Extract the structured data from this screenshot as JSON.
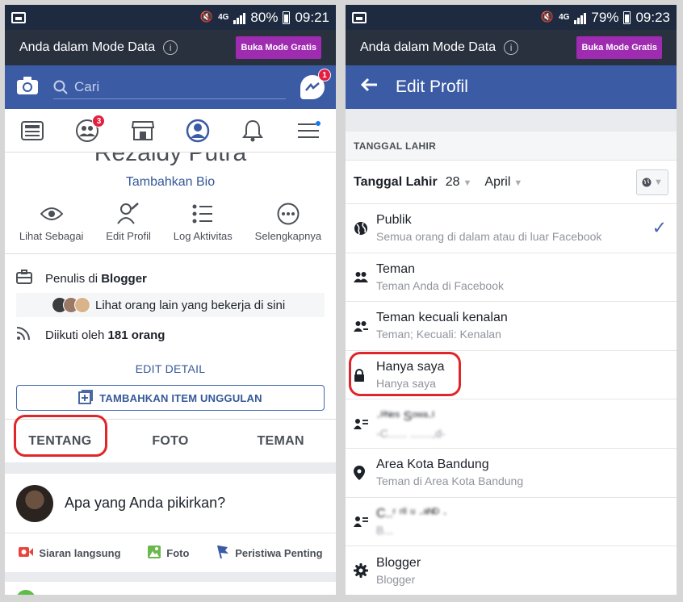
{
  "left": {
    "status": {
      "battery": "80%",
      "time": "09:21",
      "network": "4G"
    },
    "data_mode": {
      "text": "Anda dalam Mode Data",
      "button": "Buka Mode Gratis"
    },
    "search": {
      "placeholder": "Cari"
    },
    "messenger_badge": "1",
    "nav": {
      "friends_badge": "3"
    },
    "profile": {
      "name_partial": "Rezaldy Putra",
      "bio_link": "Tambahkan Bio",
      "actions": [
        {
          "label": "Lihat Sebagai",
          "icon": "eye-icon"
        },
        {
          "label": "Edit Profil",
          "icon": "edit-profile-icon"
        },
        {
          "label": "Log Aktivitas",
          "icon": "list-icon"
        },
        {
          "label": "Selengkapnya",
          "icon": "more-icon"
        }
      ]
    },
    "details": {
      "work_prefix": "Penulis di ",
      "work_place": "Blogger",
      "coworkers": "Lihat orang lain yang bekerja di sini",
      "followers_prefix": "Diikuti oleh ",
      "followers_count": "181 orang",
      "edit_detail": "EDIT DETAIL",
      "featured_button": "TAMBAHKAN ITEM UNGGULAN"
    },
    "tabs": [
      "TENTANG",
      "FOTO",
      "TEMAN"
    ],
    "composer": {
      "prompt": "Apa yang Anda pikirkan?",
      "actions": [
        "Siaran langsung",
        "Foto",
        "Peristiwa Penting"
      ]
    }
  },
  "right": {
    "status": {
      "battery": "79%",
      "time": "09:23",
      "network": "4G"
    },
    "data_mode": {
      "text": "Anda dalam Mode Data",
      "button": "Buka Mode Gratis"
    },
    "title": "Edit Profil",
    "section": "TANGGAL LAHIR",
    "dob": {
      "label": "Tanggal Lahir",
      "day": "28",
      "month": "April"
    },
    "options": [
      {
        "title": "Publik",
        "sub": "Semua orang di dalam atau di luar Facebook",
        "icon": "globe-icon",
        "selected": true
      },
      {
        "title": "Teman",
        "sub": "Teman Anda di Facebook",
        "icon": "friends-icon",
        "selected": false
      },
      {
        "title": "Teman kecuali kenalan",
        "sub": "Teman; Kecuali: Kenalan",
        "icon": "friends-except-icon",
        "selected": false
      },
      {
        "title": "Hanya saya",
        "sub": "Hanya saya",
        "icon": "lock-icon",
        "selected": false
      },
      {
        "title": "·ᴵⁱᴺᵉˢ Sᵒʷᵃ·ᴵ",
        "sub": "-C...... .......,d-",
        "icon": "list-person-icon",
        "selected": false
      },
      {
        "title": "Area Kota Bandung",
        "sub": "Teman di Area Kota Bandung",
        "icon": "location-icon",
        "selected": false
      },
      {
        "title": "C..ʳ ʳᴵˡ ᵘ ·ᵃᴺᴰ ·",
        "sub": "B...",
        "icon": "list-person-icon",
        "selected": false
      },
      {
        "title": "Blogger",
        "sub": "Blogger",
        "icon": "gear-icon",
        "selected": false
      }
    ]
  },
  "colors": {
    "fb_blue": "#3b5ba5",
    "highlight_red": "#e0262a",
    "data_button": "#9e2bb0",
    "status_bar": "#1d2a3f"
  }
}
